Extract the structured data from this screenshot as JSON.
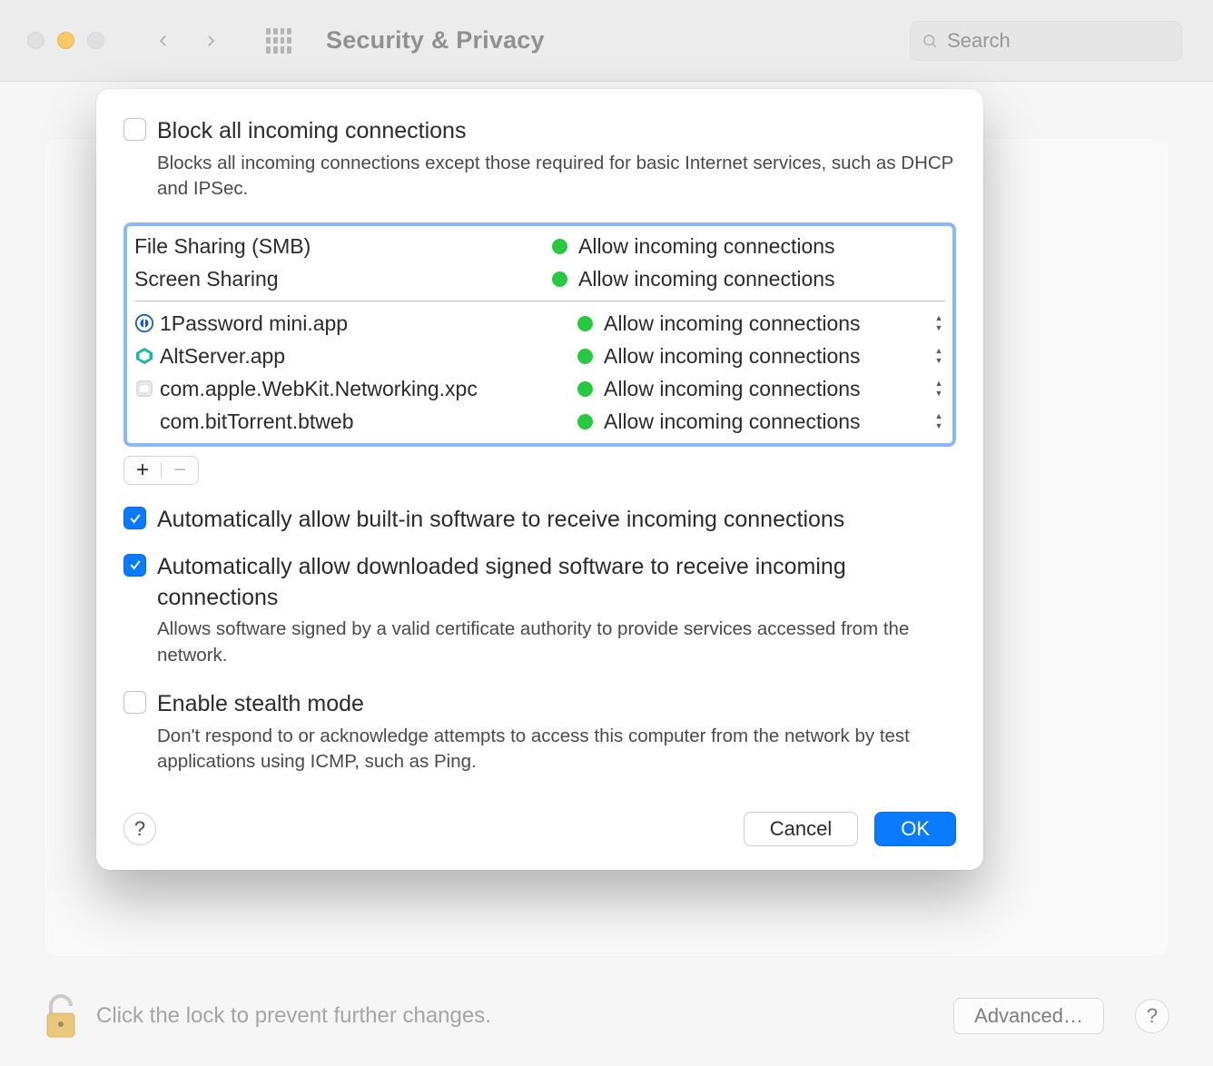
{
  "toolbar": {
    "title": "Security & Privacy",
    "search_placeholder": "Search"
  },
  "sheet": {
    "block_all": {
      "checked": false,
      "label": "Block all incoming connections",
      "desc": "Blocks all incoming connections except those required for basic Internet services, such as DHCP and IPSec."
    },
    "system_services": [
      {
        "name": "File Sharing (SMB)",
        "status": "Allow incoming connections"
      },
      {
        "name": "Screen Sharing",
        "status": "Allow incoming connections"
      }
    ],
    "apps": [
      {
        "name": "1Password mini.app",
        "status": "Allow incoming connections",
        "icon": "onepassword"
      },
      {
        "name": "AltServer.app",
        "status": "Allow incoming connections",
        "icon": "altserver"
      },
      {
        "name": "com.apple.WebKit.Networking.xpc",
        "status": "Allow incoming connections",
        "icon": "xpc"
      },
      {
        "name": "com.bitTorrent.btweb",
        "status": "Allow incoming connections",
        "icon": "none"
      }
    ],
    "add_label": "+",
    "remove_label": "−",
    "auto_builtin": {
      "checked": true,
      "label": "Automatically allow built-in software to receive incoming connections"
    },
    "auto_signed": {
      "checked": true,
      "label": "Automatically allow downloaded signed software to receive incoming connections",
      "desc": "Allows software signed by a valid certificate authority to provide services accessed from the network."
    },
    "stealth": {
      "checked": false,
      "label": "Enable stealth mode",
      "desc": "Don't respond to or acknowledge attempts to access this computer from the network by test applications using ICMP, such as Ping."
    },
    "help_label": "?",
    "cancel_label": "Cancel",
    "ok_label": "OK"
  },
  "footer": {
    "lock_text": "Click the lock to prevent further changes.",
    "advanced_label": "Advanced…",
    "help_label": "?"
  }
}
